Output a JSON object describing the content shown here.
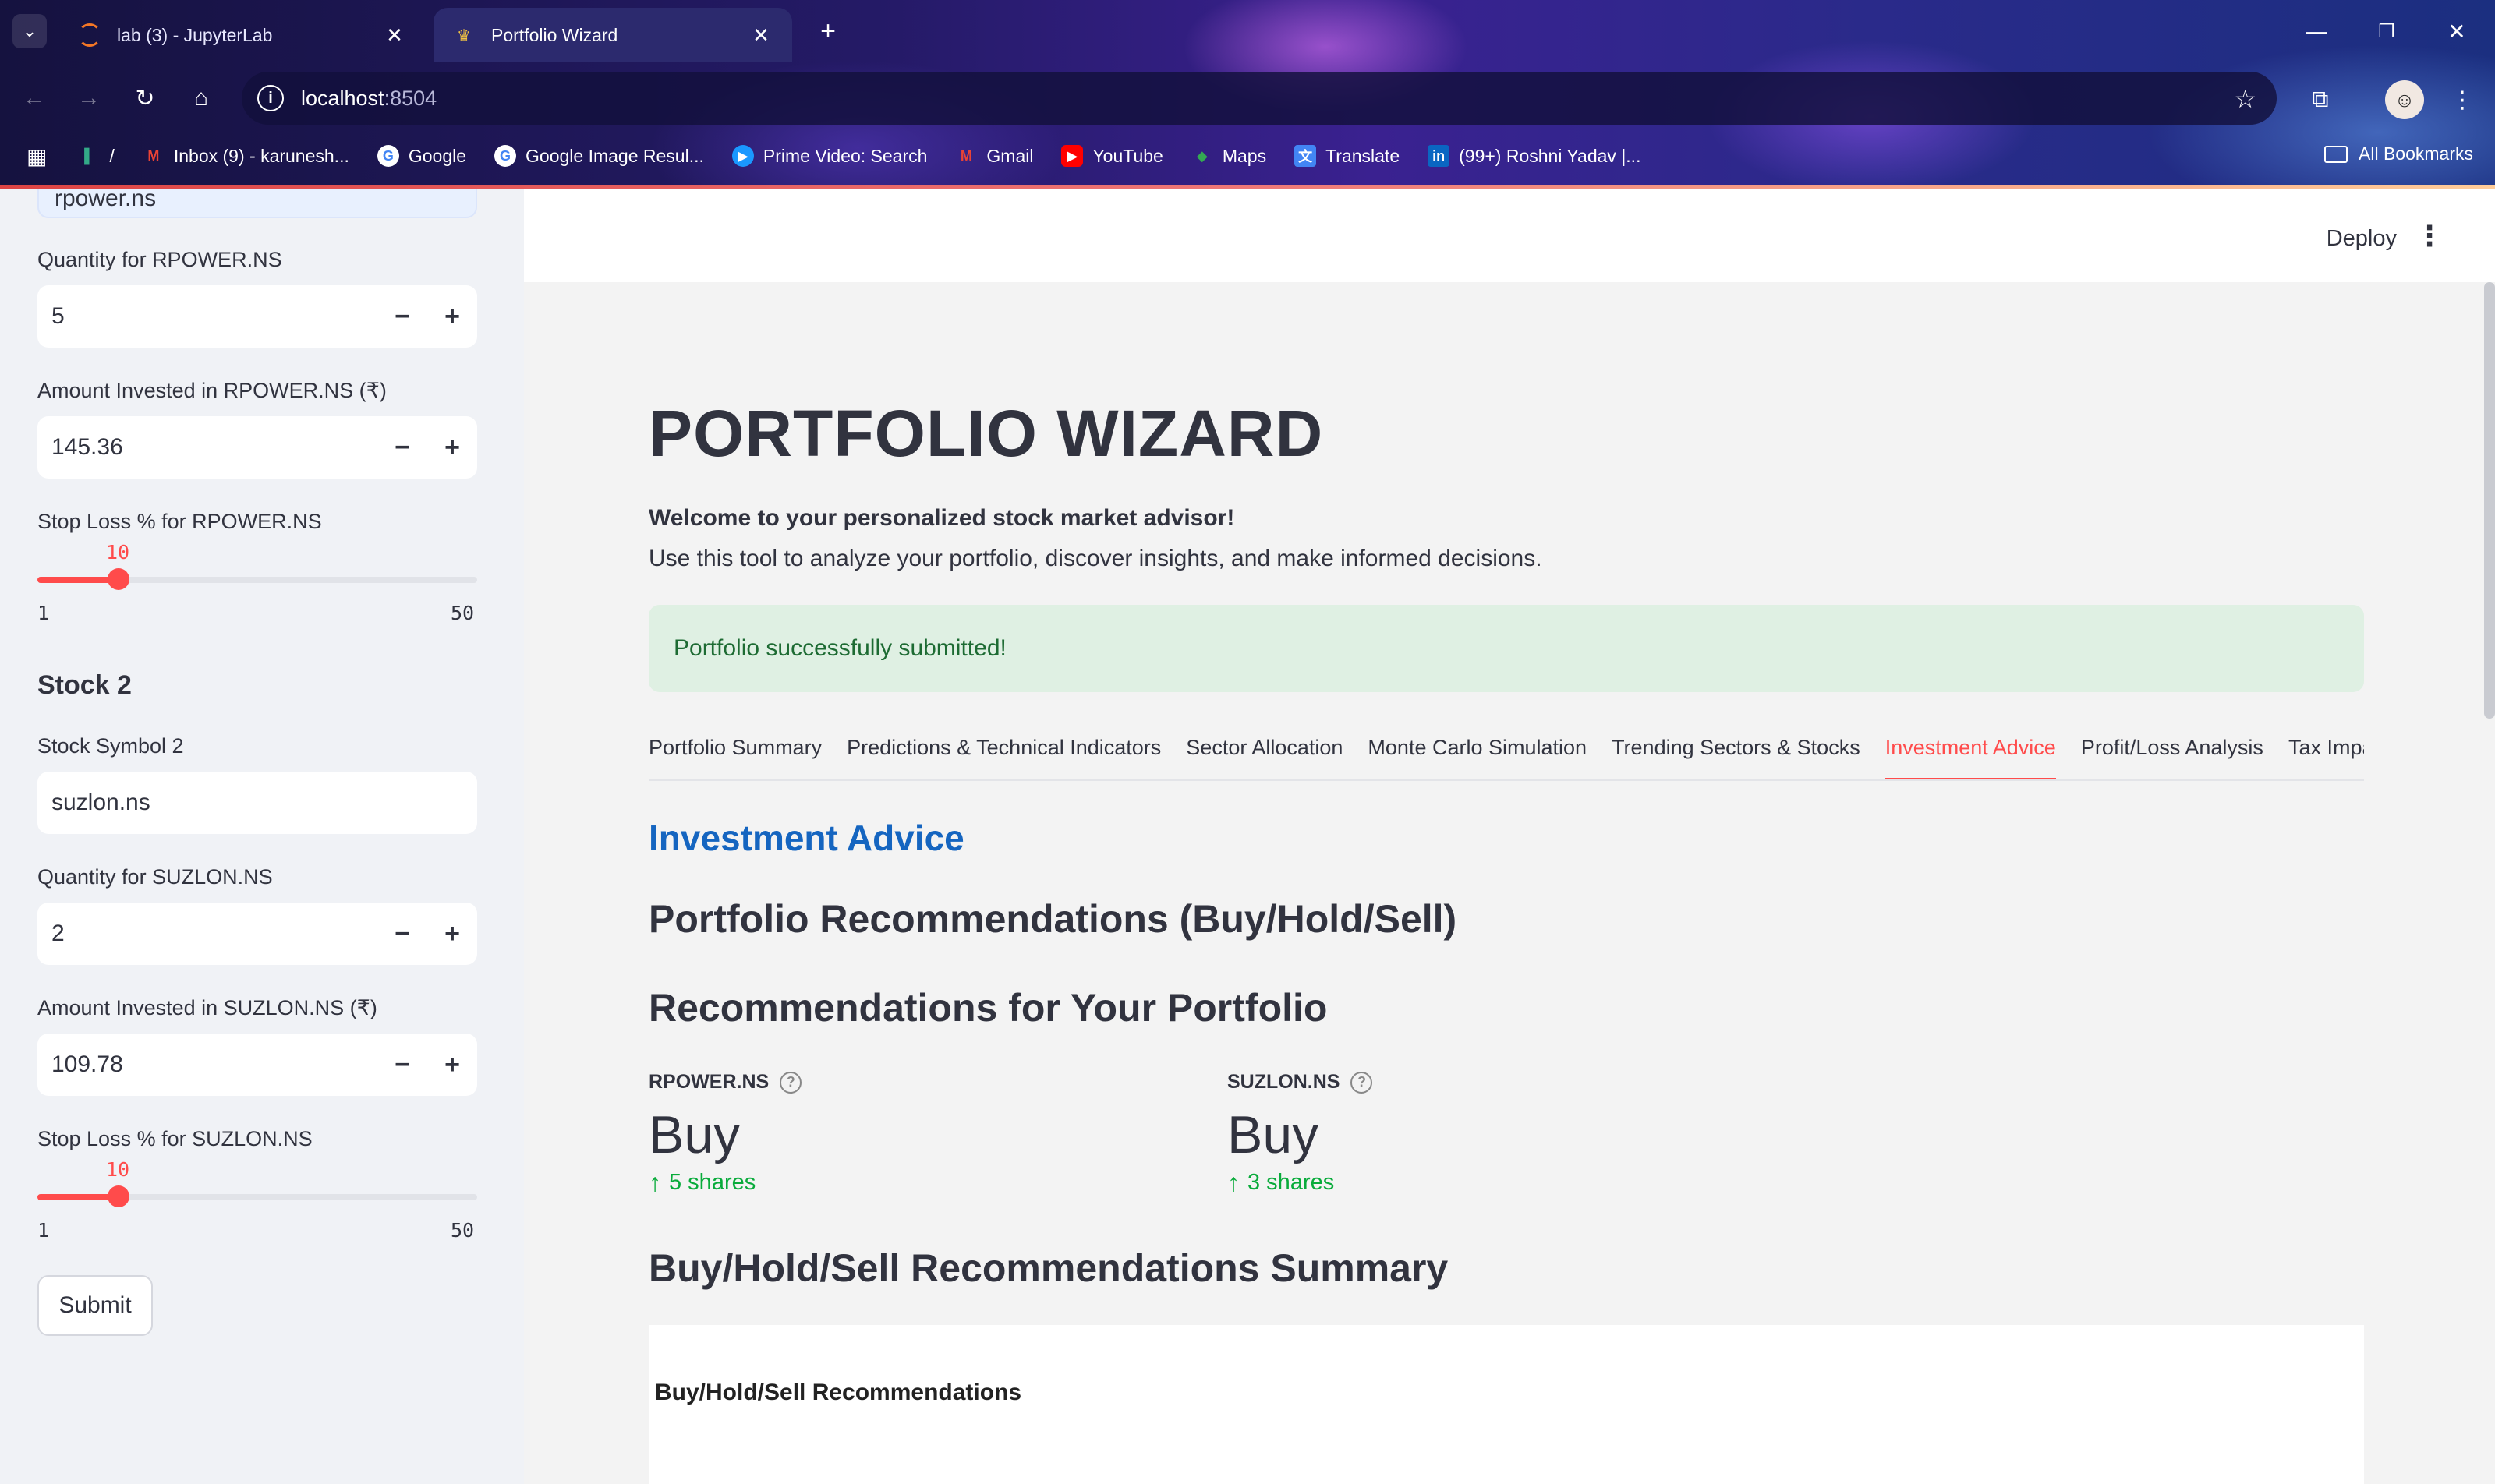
{
  "browser": {
    "tabs": [
      {
        "title": "lab (3) - JupyterLab",
        "active": false
      },
      {
        "title": "Portfolio Wizard",
        "active": true
      }
    ],
    "address": {
      "host": "localhost",
      "port": ":8504"
    },
    "bookmarks": [
      {
        "label": "/",
        "icon": "folder-slash-icon"
      },
      {
        "label": "Inbox (9) - karunesh...",
        "icon": "gmail-icon"
      },
      {
        "label": "Google",
        "icon": "google-icon"
      },
      {
        "label": "Google Image Resul...",
        "icon": "google-icon"
      },
      {
        "label": "Prime Video: Search",
        "icon": "prime-video-icon"
      },
      {
        "label": "Gmail",
        "icon": "gmail-icon"
      },
      {
        "label": "YouTube",
        "icon": "youtube-icon"
      },
      {
        "label": "Maps",
        "icon": "maps-icon"
      },
      {
        "label": "Translate",
        "icon": "translate-icon"
      },
      {
        "label": "(99+) Roshni Yadav |...",
        "icon": "linkedin-icon"
      }
    ],
    "all_bookmarks": "All Bookmarks"
  },
  "sidebar": {
    "cut_input_value": "rpower.ns",
    "stock1": {
      "quantity_label": "Quantity for RPOWER.NS",
      "quantity_value": "5",
      "amount_label": "Amount Invested in RPOWER.NS (₹)",
      "amount_value": "145.36",
      "stoploss_label": "Stop Loss % for RPOWER.NS",
      "stoploss_value": "10",
      "stoploss_fraction": 0.1837,
      "min": "1",
      "max": "50"
    },
    "stock2": {
      "heading": "Stock 2",
      "symbol_label": "Stock Symbol 2",
      "symbol_value": "suzlon.ns",
      "quantity_label": "Quantity for SUZLON.NS",
      "quantity_value": "2",
      "amount_label": "Amount Invested in SUZLON.NS (₹)",
      "amount_value": "109.78",
      "stoploss_label": "Stop Loss % for SUZLON.NS",
      "stoploss_value": "10",
      "stoploss_fraction": 0.1837,
      "min": "1",
      "max": "50"
    },
    "submit_label": "Submit"
  },
  "header": {
    "deploy_label": "Deploy"
  },
  "main": {
    "title": "PORTFOLIO WIZARD",
    "welcome": "Welcome to your personalized stock market advisor!",
    "intro": "Use this tool to analyze your portfolio, discover insights, and make informed decisions.",
    "success_message": "Portfolio successfully submitted!",
    "tabs": [
      {
        "label": "Portfolio Summary",
        "active": false
      },
      {
        "label": "Predictions & Technical Indicators",
        "active": false
      },
      {
        "label": "Sector Allocation",
        "active": false
      },
      {
        "label": "Monte Carlo Simulation",
        "active": false
      },
      {
        "label": "Trending Sectors & Stocks",
        "active": false
      },
      {
        "label": "Investment Advice",
        "active": true
      },
      {
        "label": "Profit/Loss Analysis",
        "active": false
      },
      {
        "label": "Tax Impact",
        "active": false
      }
    ],
    "section_title": "Investment Advice",
    "h2_recs": "Portfolio Recommendations (Buy/Hold/Sell)",
    "h2_your": "Recommendations for Your Portfolio",
    "metrics": [
      {
        "label": "RPOWER.NS",
        "value": "Buy",
        "delta": "5 shares"
      },
      {
        "label": "SUZLON.NS",
        "value": "Buy",
        "delta": "3 shares"
      }
    ],
    "h2_summary": "Buy/Hold/Sell Recommendations Summary",
    "chart_title": "Buy/Hold/Sell Recommendations"
  },
  "colors": {
    "accent": "#ff4b4b",
    "success_text": "#1d6b33",
    "link_blue": "#1565c0",
    "delta_green": "#09ab3b"
  }
}
